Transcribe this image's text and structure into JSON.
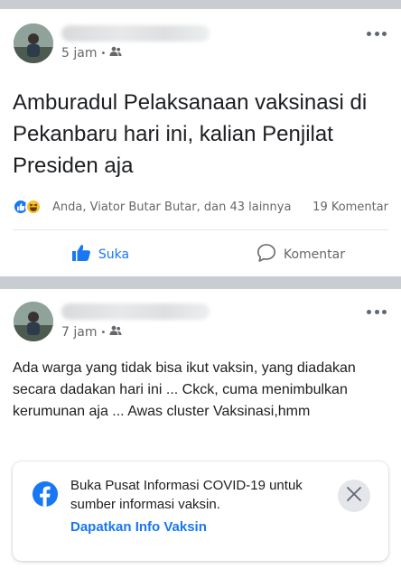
{
  "post1": {
    "time": "5 jam",
    "text": "Amburadul Pelaksanaan vaksinasi di Pekanbaru hari ini, kalian Penjilat Presiden aja",
    "reactions_text": "Anda, Viator Butar Butar, dan 43 lainnya",
    "comments_text": "19 Komentar",
    "like_label": "Suka",
    "comment_label": "Komentar",
    "icons": [
      "like-reaction-icon",
      "haha-reaction-icon",
      "friends-audience-icon",
      "more-options-icon",
      "thumbs-up-icon",
      "comment-icon"
    ]
  },
  "post2": {
    "time": "7 jam",
    "text": "Ada warga yang tidak bisa ikut vaksin, yang diadakan secara dadakan hari ini ... Ckck, cuma menimbulkan kerumunan aja ... Awas cluster Vaksinasi,hmm",
    "info_box": {
      "title": "Buka Pusat Informasi COVID-19 untuk sumber informasi vaksin.",
      "link": "Dapatkan Info Vaksin",
      "icons": [
        "facebook-logo-icon",
        "close-icon"
      ]
    }
  },
  "colors": {
    "accent": "#1877f2",
    "secondary_text": "#65676b",
    "background": "#c9ccd1"
  }
}
